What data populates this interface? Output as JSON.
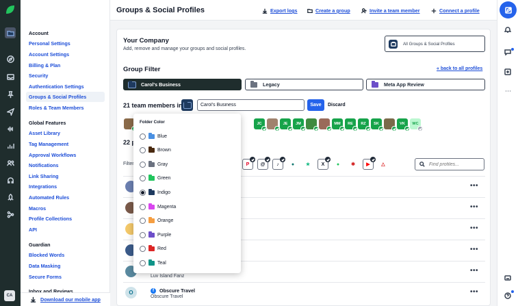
{
  "app": {
    "title": "Groups & Social Profiles",
    "user_initials": "CA",
    "accent": "#2563eb"
  },
  "topbar": {
    "export_logs": "Export logs",
    "create_group": "Create a group",
    "invite_member": "Invite a team member",
    "connect_profile": "Connect a profile"
  },
  "nav": {
    "account_heading": "Account",
    "account_items": [
      "Personal Settings",
      "Account Settings",
      "Billing & Plan",
      "Security",
      "Authentication Settings",
      "Groups & Social Profiles",
      "Roles & Team Members"
    ],
    "global_heading": "Global Features",
    "global_items": [
      "Asset Library",
      "Tag Management",
      "Approval Workflows",
      "Notifications",
      "Link Sharing",
      "Integrations",
      "Automated Rules",
      "Macros",
      "Profile Collections",
      "API"
    ],
    "guardian_heading": "Guardian",
    "guardian_items": [
      "Blocked Words",
      "Data Masking",
      "Secure Forms"
    ],
    "inbox_heading": "Inbox and Reviews",
    "download_app": "Download our mobile app"
  },
  "company": {
    "title": "Your Company",
    "subtitle": "Add, remove and manage your groups and social profiles.",
    "all_groups_btn": "All Groups & Social Profiles"
  },
  "group_filter": {
    "title": "Group Filter",
    "back_link": "« back to all profiles",
    "groups": [
      {
        "name": "Carol's Business",
        "color": "#1e3a5f"
      },
      {
        "name": "Legacy",
        "color": "#6b7280"
      },
      {
        "name": "Meta App Review",
        "color": "#6d4fc9"
      }
    ]
  },
  "editor": {
    "team_count_text": "21 team members in",
    "group_name_value": "Carol's Business",
    "save_label": "Save",
    "discard_label": "Discard"
  },
  "members": [
    {
      "initials": "",
      "color": "#8b6b4a",
      "check": "green"
    },
    {
      "initials": "",
      "color": "#6b7a8a",
      "check": "green"
    },
    {
      "initials": "",
      "color": "#7a5a6a",
      "check": "green"
    },
    {
      "initials": "",
      "color": "#5a6b4a",
      "check": "green"
    },
    {
      "initials": "",
      "color": "#16a34a",
      "check": "green"
    },
    {
      "initials": "",
      "color": "#16a34a",
      "check": "green"
    },
    {
      "initials": "",
      "color": "#16a34a",
      "check": "green"
    },
    {
      "initials": "",
      "color": "#16a34a",
      "check": "green"
    },
    {
      "initials": "",
      "color": "#16a34a",
      "check": "green"
    },
    {
      "initials": "",
      "color": "#16a34a",
      "check": "green"
    },
    {
      "initials": "JC",
      "color": "#16a34a",
      "check": "green"
    },
    {
      "initials": "",
      "color": "#a0826d",
      "check": "green"
    },
    {
      "initials": "JE",
      "color": "#16a34a",
      "check": "green"
    },
    {
      "initials": "JM",
      "color": "#16a34a",
      "check": "green"
    },
    {
      "initials": "",
      "color": "#3f8a3f",
      "check": "green"
    },
    {
      "initials": "",
      "color": "#9a6b5a",
      "check": "green"
    },
    {
      "initials": "MM",
      "color": "#16a34a",
      "check": "green"
    },
    {
      "initials": "RE",
      "color": "#16a34a",
      "check": "green"
    },
    {
      "initials": "RZ",
      "color": "#16a34a",
      "check": "green"
    },
    {
      "initials": "SK",
      "color": "#16a34a",
      "check": "green"
    },
    {
      "initials": "",
      "color": "#7a6a4a",
      "check": "green"
    },
    {
      "initials": "VK",
      "color": "#16a34a",
      "check": "green"
    },
    {
      "initials": "WC",
      "color": "#bbf7d0",
      "check": "grey"
    }
  ],
  "profiles_section": {
    "count_text": "22 p",
    "filter_label": "Filter",
    "search_placeholder": "Find profiles..."
  },
  "networks": [
    {
      "icon": "pinterest-icon",
      "glyph": "P",
      "color": "#e60023",
      "boxed": true
    },
    {
      "icon": "threads-icon",
      "glyph": "@",
      "color": "#111827",
      "boxed": true
    },
    {
      "icon": "tiktok-icon",
      "glyph": "♪",
      "color": "#111827",
      "boxed": true
    },
    {
      "icon": "circle-icon",
      "glyph": "●",
      "color": "#0f766e",
      "boxed": false
    },
    {
      "icon": "star-icon",
      "glyph": "★",
      "color": "#10b981",
      "boxed": false
    },
    {
      "icon": "x-icon",
      "glyph": "X",
      "color": "#111827",
      "boxed": true
    },
    {
      "icon": "whatsapp-icon",
      "glyph": "●",
      "color": "#22c55e",
      "boxed": false
    },
    {
      "icon": "yelp-icon",
      "glyph": "✱",
      "color": "#d32323",
      "boxed": false
    },
    {
      "icon": "youtube-icon",
      "glyph": "▶",
      "color": "#ff0000",
      "boxed": true
    },
    {
      "icon": "alert-icon",
      "glyph": "△",
      "color": "#dc2626",
      "boxed": false
    }
  ],
  "profiles": [
    {
      "name": "",
      "sub": "",
      "avatar": "#6b7fb0"
    },
    {
      "name": "",
      "sub": "",
      "avatar": "#7a5a4a"
    },
    {
      "name": "",
      "sub": "",
      "avatar": "#f4c96a"
    },
    {
      "name": "",
      "sub": "",
      "avatar": "#3b5b8a"
    },
    {
      "name": "",
      "sub": "",
      "avatar": "#5a8aa0"
    },
    {
      "name": "Obscure Travel",
      "sub": "Obscure Travel",
      "avatar": "#cfe3ea"
    }
  ],
  "partial_profile_sub": "Luv Island Fanz",
  "folder_color": {
    "heading": "Folder Color",
    "options": [
      {
        "label": "Blue",
        "color": "#4a90e2",
        "selected": false
      },
      {
        "label": "Brown",
        "color": "#4a2a10",
        "selected": false
      },
      {
        "label": "Gray",
        "color": "#6b7280",
        "selected": false
      },
      {
        "label": "Green",
        "color": "#22c55e",
        "selected": false
      },
      {
        "label": "Indigo",
        "color": "#1e3a5f",
        "selected": true
      },
      {
        "label": "Magenta",
        "color": "#d946ef",
        "selected": false
      },
      {
        "label": "Orange",
        "color": "#f59e42",
        "selected": false
      },
      {
        "label": "Purple",
        "color": "#6d4fc9",
        "selected": false
      },
      {
        "label": "Red",
        "color": "#dc2626",
        "selected": false
      },
      {
        "label": "Teal",
        "color": "#0f9488",
        "selected": false
      }
    ]
  }
}
